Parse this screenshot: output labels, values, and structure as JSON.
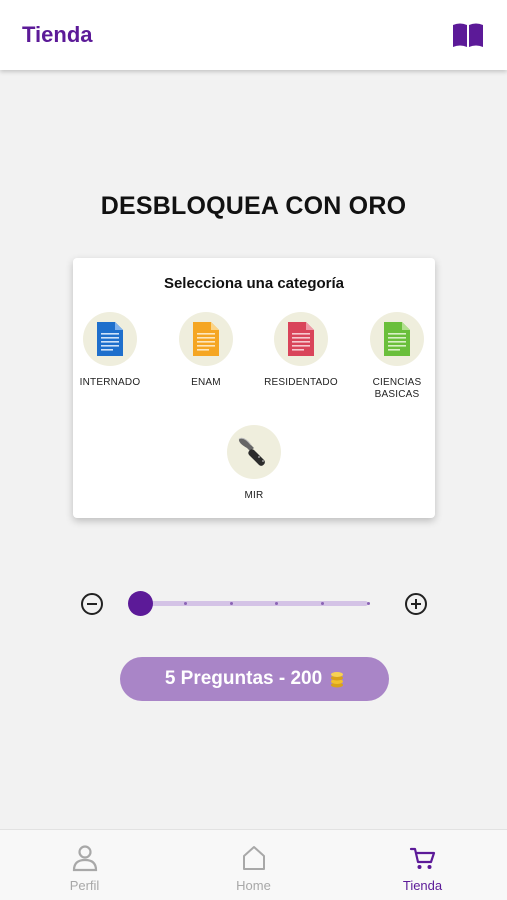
{
  "header": {
    "title": "Tienda",
    "book_icon": "book-open-icon"
  },
  "headline": "DESBLOQUEA CON ORO",
  "category_card": {
    "title": "Selecciona una categoría",
    "categories": [
      {
        "label": "INTERNADO",
        "icon": "document-blue-icon",
        "color": "#1e6fcc"
      },
      {
        "label": "ENAM",
        "icon": "document-orange-icon",
        "color": "#f5a623"
      },
      {
        "label": "RESIDENTADO",
        "icon": "document-red-icon",
        "color": "#d9445a"
      },
      {
        "label": "CIENCIAS BASICAS",
        "icon": "document-green-icon",
        "color": "#6abf3b"
      },
      {
        "label": "MIR",
        "icon": "scalpel-icon",
        "color": "#333333"
      }
    ]
  },
  "slider": {
    "minus_icon": "minus-circle-icon",
    "plus_icon": "plus-circle-icon",
    "value_fraction": 0.0,
    "steps": 6
  },
  "purchase": {
    "label": "5 Preguntas - 200",
    "coin_icon": "gold-coins-icon"
  },
  "bottom_nav": {
    "items": [
      {
        "label": "Perfil",
        "icon": "person-icon"
      },
      {
        "label": "Home",
        "icon": "home-icon"
      },
      {
        "label": "Tienda",
        "icon": "cart-icon",
        "active": true
      }
    ]
  },
  "colors": {
    "primary": "#5c1a98",
    "button": "#a985c7",
    "background": "#f2f2f2"
  }
}
